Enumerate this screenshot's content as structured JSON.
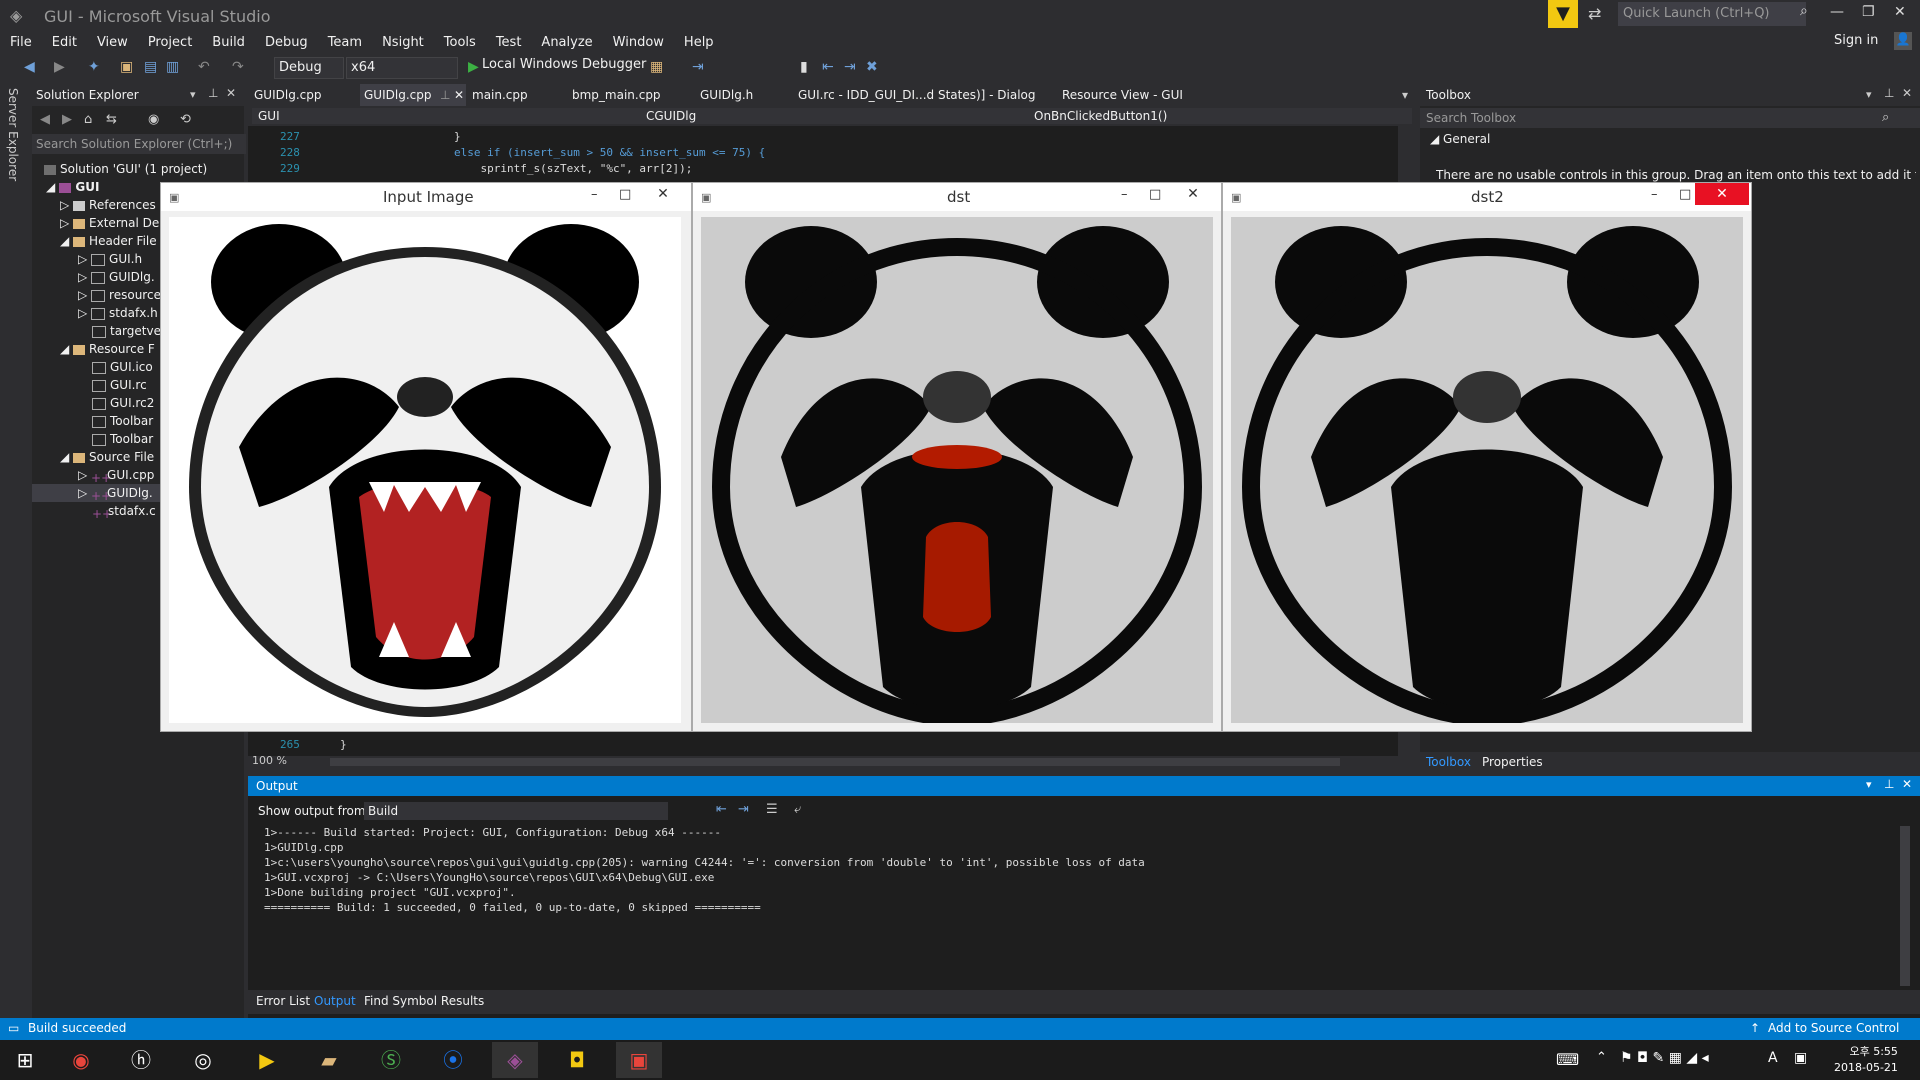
{
  "window": {
    "title": "GUI - Microsoft Visual Studio",
    "quick_launch_placeholder": "Quick Launch (Ctrl+Q)",
    "sign_in": "Sign in"
  },
  "menu": [
    "File",
    "Edit",
    "View",
    "Project",
    "Build",
    "Debug",
    "Team",
    "Nsight",
    "Tools",
    "Test",
    "Analyze",
    "Window",
    "Help"
  ],
  "toolbar": {
    "config": "Debug",
    "platform": "x64",
    "debugger": "Local Windows Debugger"
  },
  "server_explorer": {
    "label": "Server Explorer"
  },
  "solution_explorer": {
    "title": "Solution Explorer",
    "search_placeholder": "Search Solution Explorer (Ctrl+;)",
    "items": [
      "Solution 'GUI' (1 project)",
      "GUI",
      "References",
      "External De",
      "Header File",
      "GUI.h",
      "GUIDlg.",
      "resource",
      "stdafx.h",
      "targetve",
      "Resource F",
      "GUI.ico",
      "GUI.rc",
      "GUI.rc2",
      "Toolbar",
      "Toolbar",
      "Source File",
      "GUI.cpp",
      "GUIDlg.",
      "stdafx.c"
    ]
  },
  "editor": {
    "tabs": [
      "GUIDlg.cpp",
      "GUIDlg.cpp",
      "main.cpp",
      "bmp_main.cpp",
      "GUIDlg.h",
      "GUI.rc - IDD_GUI_DI...d States)] - Dialog",
      "Resource View - GUI"
    ],
    "nav": {
      "project": "GUI",
      "class": "CGUIDlg",
      "member": "OnBnClickedButton1()"
    },
    "lines": [
      {
        "n": "227",
        "code": "}"
      },
      {
        "n": "228",
        "code": "else if (insert_sum > 50 && insert_sum <= 75) {"
      },
      {
        "n": "229",
        "code": "    sprintf_s(szText, \"%c\", arr[2]);"
      },
      {
        "n": "265",
        "code": "}"
      }
    ],
    "zoom": "100 %"
  },
  "toolbox": {
    "title": "Toolbox",
    "search_placeholder": "Search Toolbox",
    "group": "General",
    "message": "There are no usable controls in this group. Drag an item onto this text to add it to the",
    "tabs": [
      "Toolbox",
      "Properties"
    ]
  },
  "output": {
    "title": "Output",
    "show_from_label": "Show output from:",
    "source": "Build",
    "lines": [
      "1>------ Build started: Project: GUI, Configuration: Debug x64 ------",
      "1>GUIDlg.cpp",
      "1>c:\\users\\youngho\\source\\repos\\gui\\gui\\guidlg.cpp(205): warning C4244: '=': conversion from 'double' to 'int', possible loss of data",
      "1>GUI.vcxproj -> C:\\Users\\YoungHo\\source\\repos\\GUI\\x64\\Debug\\GUI.exe",
      "1>Done building project \"GUI.vcxproj\".",
      "========== Build: 1 succeeded, 0 failed, 0 up-to-date, 0 skipped =========="
    ],
    "bottom_tabs": [
      "Error List",
      "Output",
      "Find Symbol Results"
    ]
  },
  "status": {
    "text": "Build succeeded",
    "source_control": "Add to Source Control"
  },
  "image_windows": [
    {
      "title": "Input Image"
    },
    {
      "title": "dst"
    },
    {
      "title": "dst2"
    }
  ],
  "tray": {
    "time": "오후 5:55",
    "date": "2018-05-21",
    "lang": "A"
  }
}
